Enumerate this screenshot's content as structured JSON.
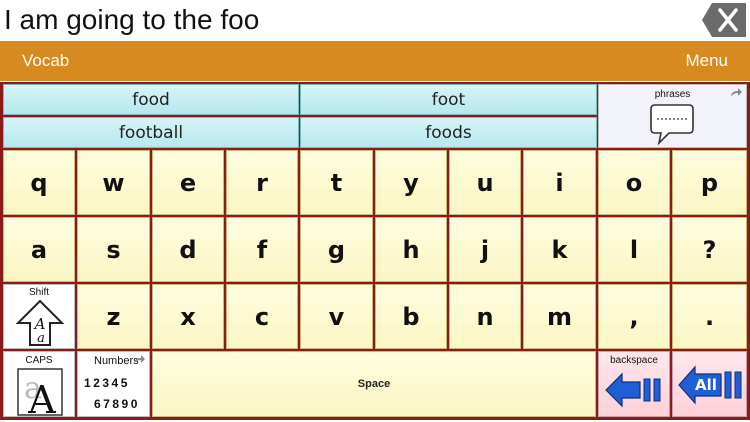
{
  "message": {
    "text": "I am going to the foo"
  },
  "toolbar": {
    "vocab_label": "Vocab",
    "menu_label": "Menu"
  },
  "predictions": [
    "food",
    "foot",
    "football",
    "foods"
  ],
  "phrases": {
    "label": "phrases"
  },
  "rows": [
    [
      "q",
      "w",
      "e",
      "r",
      "t",
      "y",
      "u",
      "i",
      "o",
      "p"
    ],
    [
      "a",
      "s",
      "d",
      "f",
      "g",
      "h",
      "j",
      "k",
      "l",
      "?"
    ],
    [
      "z",
      "x",
      "c",
      "v",
      "b",
      "n",
      "m",
      ",",
      "."
    ]
  ],
  "shift": {
    "label": "Shift"
  },
  "caps": {
    "label": "CAPS"
  },
  "numbers": {
    "label": "Numbers",
    "line1": "12345",
    "line2": "67890"
  },
  "space": {
    "label": "Space"
  },
  "backspace": {
    "label": "backspace"
  },
  "clear_all": {
    "label": "All"
  },
  "colors": {
    "menu_bar": "#d78a1f",
    "grid_border": "#8c1a1a",
    "arrow_blue": "#1f5fd6"
  }
}
